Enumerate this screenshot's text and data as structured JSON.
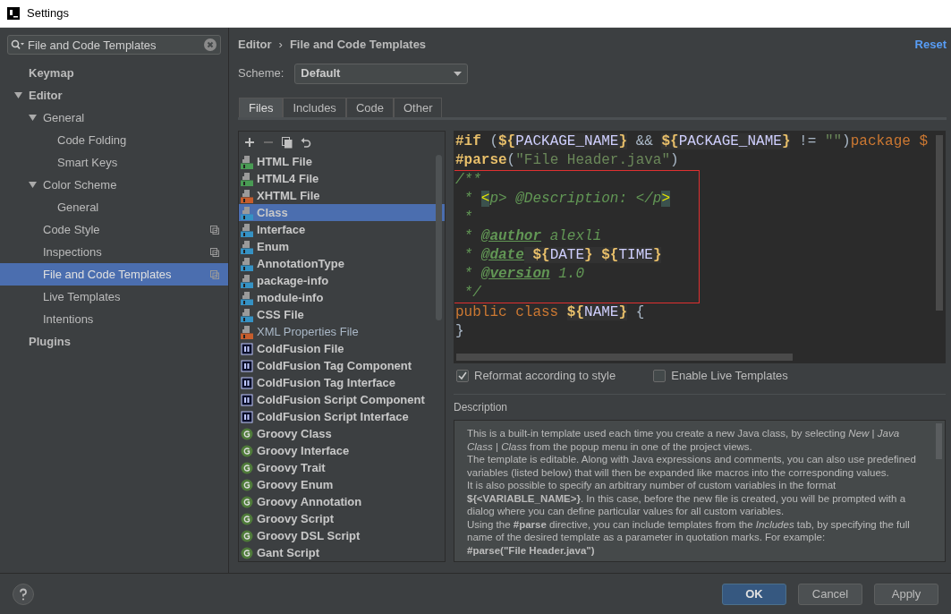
{
  "window": {
    "title": "Settings"
  },
  "search": {
    "value": "File and Code Templates"
  },
  "sidebar": {
    "items": [
      {
        "label": "Keymap",
        "selected": false
      },
      {
        "label": "Editor",
        "selected": false,
        "expanded": true,
        "children": [
          {
            "label": "General",
            "selected": false,
            "expanded": true,
            "children": [
              {
                "label": "Code Folding",
                "selected": false
              },
              {
                "label": "Smart Keys",
                "selected": false
              }
            ]
          },
          {
            "label": "Color Scheme",
            "selected": false,
            "expanded": true,
            "children": [
              {
                "label": "General",
                "selected": false
              }
            ]
          },
          {
            "label": "Code Style",
            "selected": false,
            "project_scope": true
          },
          {
            "label": "Inspections",
            "selected": false,
            "project_scope": true
          },
          {
            "label": "File and Code Templates",
            "selected": true,
            "project_scope": true
          },
          {
            "label": "Live Templates",
            "selected": false
          },
          {
            "label": "Intentions",
            "selected": false
          }
        ]
      },
      {
        "label": "Plugins",
        "selected": false
      }
    ]
  },
  "breadcrumb": [
    "Editor",
    "›",
    "File and Code Templates"
  ],
  "reset_link": "Reset",
  "scheme": {
    "label": "Scheme:",
    "value": "Default"
  },
  "tabs": [
    {
      "label": "Files",
      "selected": true
    },
    {
      "label": "Includes",
      "selected": false
    },
    {
      "label": "Code",
      "selected": false
    },
    {
      "label": "Other",
      "selected": false
    }
  ],
  "templates": [
    {
      "label": "HTML File",
      "kind": "html",
      "bold": true,
      "selected": false
    },
    {
      "label": "HTML4 File",
      "kind": "html",
      "bold": true,
      "selected": false
    },
    {
      "label": "XHTML File",
      "kind": "xhtml",
      "bold": true,
      "selected": false
    },
    {
      "label": "Class",
      "kind": "java",
      "bold": true,
      "selected": true
    },
    {
      "label": "Interface",
      "kind": "java",
      "bold": true,
      "selected": false
    },
    {
      "label": "Enum",
      "kind": "java",
      "bold": true,
      "selected": false
    },
    {
      "label": "AnnotationType",
      "kind": "java",
      "bold": true,
      "selected": false
    },
    {
      "label": "package-info",
      "kind": "java",
      "bold": true,
      "selected": false
    },
    {
      "label": "module-info",
      "kind": "java",
      "bold": true,
      "selected": false
    },
    {
      "label": "CSS File",
      "kind": "css",
      "bold": true,
      "selected": false
    },
    {
      "label": "XML Properties File",
      "kind": "xml",
      "bold": false,
      "selected": false
    },
    {
      "label": "ColdFusion File",
      "kind": "coldfusion",
      "bold": true,
      "selected": false
    },
    {
      "label": "ColdFusion Tag Component",
      "kind": "coldfusion",
      "bold": true,
      "selected": false
    },
    {
      "label": "ColdFusion Tag Interface",
      "kind": "coldfusion",
      "bold": true,
      "selected": false
    },
    {
      "label": "ColdFusion Script Component",
      "kind": "coldfusion",
      "bold": true,
      "selected": false
    },
    {
      "label": "ColdFusion Script Interface",
      "kind": "coldfusion",
      "bold": true,
      "selected": false
    },
    {
      "label": "Groovy Class",
      "kind": "groovy",
      "bold": true,
      "selected": false
    },
    {
      "label": "Groovy Interface",
      "kind": "groovy",
      "bold": true,
      "selected": false
    },
    {
      "label": "Groovy Trait",
      "kind": "groovy",
      "bold": true,
      "selected": false
    },
    {
      "label": "Groovy Enum",
      "kind": "groovy",
      "bold": true,
      "selected": false
    },
    {
      "label": "Groovy Annotation",
      "kind": "groovy",
      "bold": true,
      "selected": false
    },
    {
      "label": "Groovy Script",
      "kind": "groovy",
      "bold": true,
      "selected": false
    },
    {
      "label": "Groovy DSL Script",
      "kind": "groovy",
      "bold": true,
      "selected": false
    },
    {
      "label": "Gant Script",
      "kind": "groovy",
      "bold": true,
      "selected": false
    }
  ],
  "code": [
    {
      "highlighted": false,
      "tokens": [
        {
          "kind": "directive",
          "text": "#if"
        },
        {
          "kind": "plain",
          "text": " ("
        },
        {
          "kind": "brace",
          "text": "${"
        },
        {
          "kind": "varname",
          "text": "PACKAGE_NAME"
        },
        {
          "kind": "brace",
          "text": "}"
        },
        {
          "kind": "plain",
          "text": " && "
        },
        {
          "kind": "brace",
          "text": "${"
        },
        {
          "kind": "varname",
          "text": "PACKAGE_NAME"
        },
        {
          "kind": "brace",
          "text": "}"
        },
        {
          "kind": "plain",
          "text": " != "
        },
        {
          "kind": "string",
          "text": "\"\""
        },
        {
          "kind": "plain",
          "text": ")"
        },
        {
          "kind": "keyword",
          "text": "package $"
        }
      ]
    },
    {
      "highlighted": false,
      "tokens": [
        {
          "kind": "directive",
          "text": "#parse"
        },
        {
          "kind": "plain",
          "text": "("
        },
        {
          "kind": "string",
          "text": "\"File Header.java\""
        },
        {
          "kind": "plain",
          "text": ")"
        }
      ]
    },
    {
      "highlighted": true,
      "tokens": [
        {
          "kind": "comment",
          "text": "/**"
        }
      ]
    },
    {
      "highlighted": true,
      "tokens": [
        {
          "kind": "comment",
          "text": " * "
        },
        {
          "kind": "tag",
          "text": "<"
        },
        {
          "kind": "comment",
          "text": "p> @Description: </p"
        },
        {
          "kind": "tag",
          "text": ">"
        }
      ]
    },
    {
      "highlighted": true,
      "tokens": [
        {
          "kind": "comment",
          "text": " *"
        }
      ]
    },
    {
      "highlighted": true,
      "tokens": [
        {
          "kind": "comment",
          "text": " * "
        },
        {
          "kind": "doctag",
          "text": "@author"
        },
        {
          "kind": "comment",
          "text": " alexli"
        }
      ]
    },
    {
      "highlighted": true,
      "tokens": [
        {
          "kind": "comment",
          "text": " * "
        },
        {
          "kind": "doctag",
          "text": "@date"
        },
        {
          "kind": "brace",
          "text": " ${"
        },
        {
          "kind": "varname",
          "text": "DATE"
        },
        {
          "kind": "brace",
          "text": "}"
        },
        {
          "kind": "brace",
          "text": " ${"
        },
        {
          "kind": "varname",
          "text": "TIME"
        },
        {
          "kind": "brace",
          "text": "}"
        }
      ]
    },
    {
      "highlighted": true,
      "tokens": [
        {
          "kind": "comment",
          "text": " * "
        },
        {
          "kind": "doctag",
          "text": "@version"
        },
        {
          "kind": "comment",
          "text": " 1.0"
        }
      ]
    },
    {
      "highlighted": true,
      "tokens": [
        {
          "kind": "comment",
          "text": " */"
        }
      ]
    },
    {
      "highlighted": false,
      "tokens": [
        {
          "kind": "keyword",
          "text": "public class "
        },
        {
          "kind": "brace",
          "text": "${"
        },
        {
          "kind": "varname",
          "text": "NAME"
        },
        {
          "kind": "brace",
          "text": "}"
        },
        {
          "kind": "plain",
          "text": " {"
        }
      ]
    },
    {
      "highlighted": false,
      "tokens": [
        {
          "kind": "plain",
          "text": "}"
        }
      ]
    }
  ],
  "options": [
    {
      "label": "Reformat according to style",
      "checked": true
    },
    {
      "label": "Enable Live Templates",
      "checked": false
    }
  ],
  "description": {
    "title": "Description",
    "paragraphs": [
      "This is a built-in template used each time you create a new Java class, by selecting *New* | *Java Class* | *Class* from the popup menu in one of the project views.",
      "The template is editable. Along with Java expressions and comments, you can also use predefined variables (listed below) that will then be expanded like macros into the corresponding values.",
      "It is also possible to specify an arbitrary number of custom variables in the format **${<VARIABLE_NAME>}**. In this case, before the new file is created, you will be prompted with a dialog where you can define particular values for all custom variables.",
      "Using the **#parse** directive, you can include templates from the *Includes* tab, by specifying the full name of the desired template as a parameter in quotation marks. For example:",
      "**#parse(\"File Header.java\")**"
    ]
  },
  "buttons": [
    {
      "label": "OK",
      "kind": "primary"
    },
    {
      "label": "Cancel",
      "kind": "normal"
    },
    {
      "label": "Apply",
      "kind": "normal"
    }
  ]
}
